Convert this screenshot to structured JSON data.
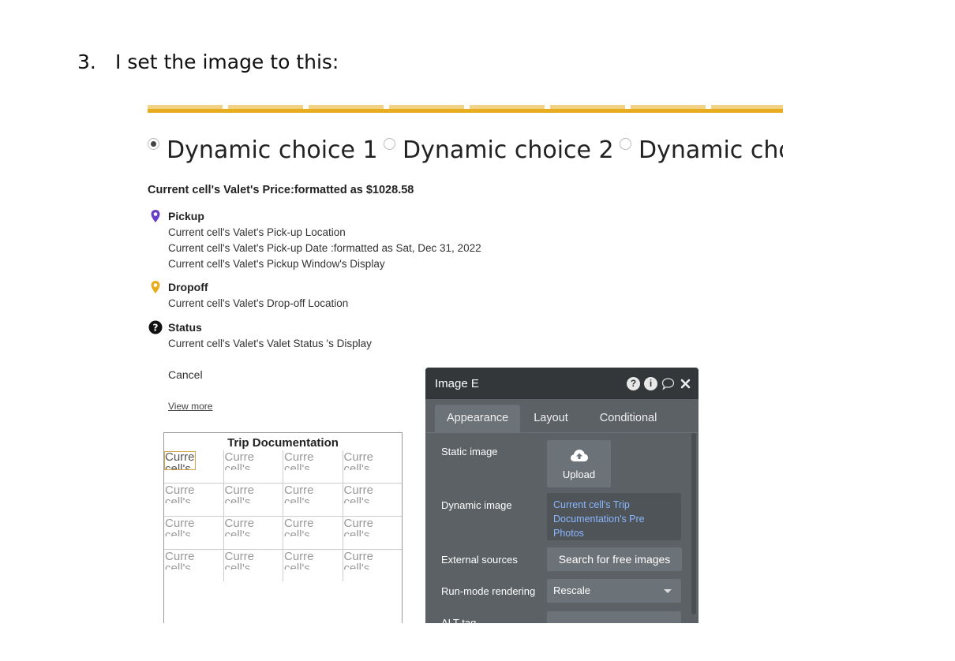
{
  "step": {
    "number": "3.",
    "text": "I set the image to this:"
  },
  "radios": [
    {
      "label": "Dynamic choice 1",
      "selected": true
    },
    {
      "label": "Dynamic choice 2",
      "selected": false
    },
    {
      "label": "Dynamic choi",
      "selected": false
    }
  ],
  "price": "Current cell's Valet's Price:formatted as $1028.58",
  "pickup": {
    "title": "Pickup",
    "icon": "map-pin-purple-icon",
    "color": "#6a3fc7",
    "lines": [
      "Current cell's Valet's Pick-up Location",
      "Current cell's Valet's Pick-up Date :formatted as Sat, Dec 31, 2022",
      "Current cell's Valet's Pickup Window's Display"
    ]
  },
  "dropoff": {
    "title": "Dropoff",
    "icon": "map-pin-yellow-icon",
    "color": "#e8ad1f",
    "lines": [
      "Current cell's Valet's Drop-off Location"
    ]
  },
  "status": {
    "title": "Status",
    "icon": "question-circle-icon",
    "lines": [
      "Current cell's Valet's Valet Status 's Display"
    ]
  },
  "cancel": "Cancel",
  "view_more": "View more",
  "trip": {
    "title": "Trip Documentation",
    "cell_line1": "Curre",
    "cell_line2": "cell's"
  },
  "panel": {
    "title": "Image E",
    "icons": [
      "question-icon",
      "info-icon",
      "comment-icon",
      "close-icon"
    ],
    "tabs": [
      "Appearance",
      "Layout",
      "Conditional"
    ],
    "active_tab": "Appearance",
    "static_image_label": "Static image",
    "upload_label": "Upload",
    "dynamic_image_label": "Dynamic image",
    "dynamic_image_value": "Current cell's Trip Documentation's Pre Photos",
    "external_sources_label": "External sources",
    "search_button": "Search for free images",
    "run_mode_label": "Run-mode rendering",
    "run_mode_value": "Rescale",
    "alt_tag_label": "ALT tag"
  },
  "colors": {
    "accent_yellow": "#e8ad1f",
    "panel_bg": "#5c6165",
    "panel_header": "#33373a",
    "link_blue": "#8ab6ff"
  }
}
